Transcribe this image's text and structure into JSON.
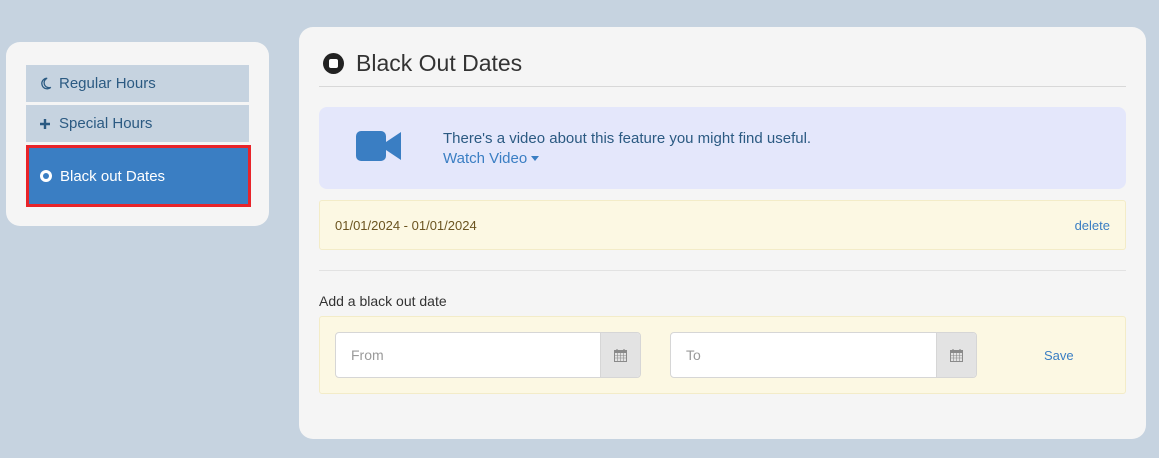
{
  "sidebar": {
    "items": [
      {
        "label": "Regular Hours",
        "icon": "moon-icon"
      },
      {
        "label": "Special Hours",
        "icon": "plus-icon"
      },
      {
        "label": "Black out Dates",
        "icon": "dot-circle-icon",
        "active": true
      }
    ]
  },
  "panel": {
    "title": "Black Out Dates",
    "video": {
      "text": "There's a video about this feature you might find useful.",
      "link_label": "Watch Video"
    },
    "existing_dates": [
      {
        "range": "01/01/2024 - 01/01/2024",
        "delete_label": "delete"
      }
    ],
    "add_form": {
      "label": "Add a black out date",
      "from_placeholder": "From",
      "to_placeholder": "To",
      "save_label": "Save"
    }
  },
  "colors": {
    "background": "#c6d3e0",
    "accent": "#3a7ec3",
    "highlight_border": "#e8242a",
    "notice_bg": "#fcf8e3",
    "video_bg": "#e4e7fb"
  }
}
